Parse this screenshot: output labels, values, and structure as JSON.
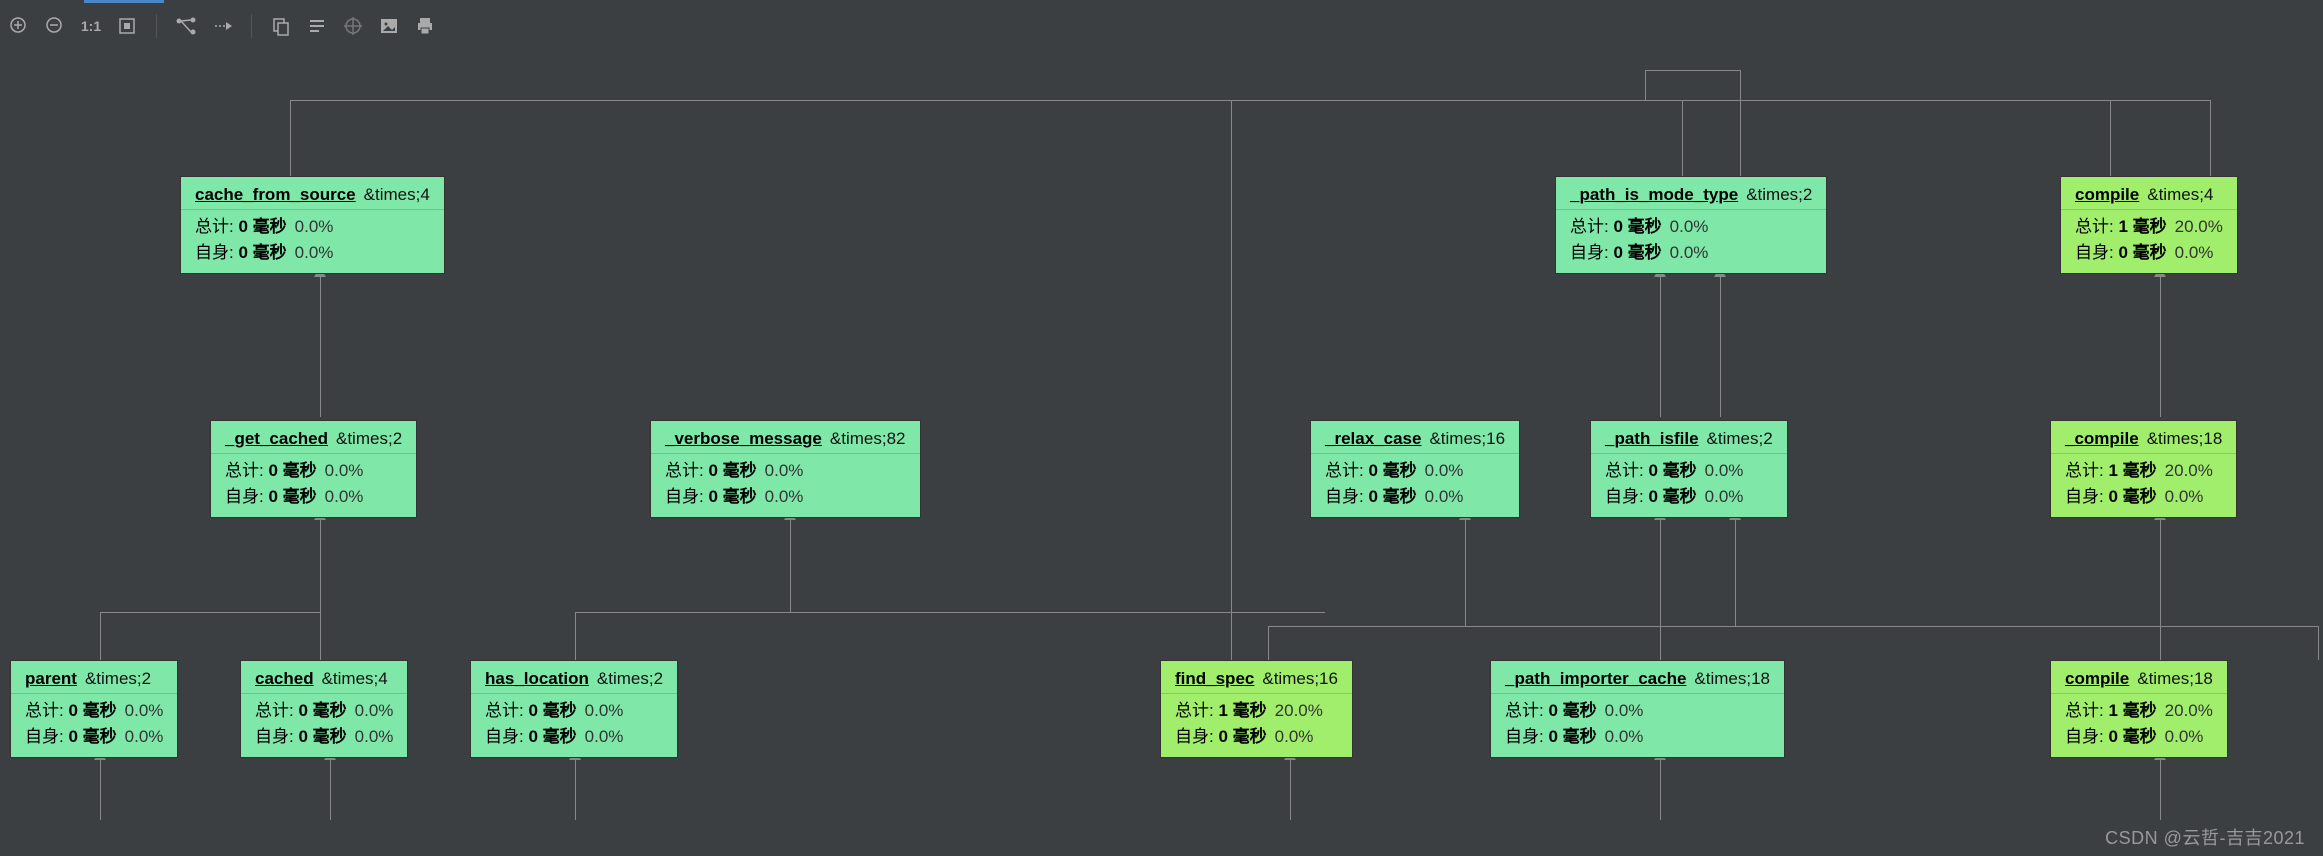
{
  "toolbar": {
    "icons": [
      "zoom-in",
      "zoom-out",
      "zoom-1-1",
      "fit",
      "graph",
      "forward",
      "copy",
      "list",
      "target",
      "image",
      "print"
    ],
    "one_to_one": "1:1"
  },
  "labels": {
    "total": "总计:",
    "self": "自身:",
    "times_prefix": "&times;"
  },
  "nodes": {
    "cache_from_source": {
      "name": "cache_from_source",
      "times": "4",
      "total_val": "0 毫秒",
      "total_pct": "0.0%",
      "self_val": "0 毫秒",
      "self_pct": "0.0%"
    },
    "path_is_mode_type": {
      "name": "_path_is_mode_type",
      "times": "2",
      "total_val": "0 毫秒",
      "total_pct": "0.0%",
      "self_val": "0 毫秒",
      "self_pct": "0.0%"
    },
    "compile_top": {
      "name": "compile",
      "times": "4",
      "total_val": "1 毫秒",
      "total_pct": "20.0%",
      "self_val": "0 毫秒",
      "self_pct": "0.0%"
    },
    "get_cached": {
      "name": "_get_cached",
      "times": "2",
      "total_val": "0 毫秒",
      "total_pct": "0.0%",
      "self_val": "0 毫秒",
      "self_pct": "0.0%"
    },
    "verbose_message": {
      "name": "_verbose_message",
      "times": "82",
      "total_val": "0 毫秒",
      "total_pct": "0.0%",
      "self_val": "0 毫秒",
      "self_pct": "0.0%"
    },
    "relax_case": {
      "name": "_relax_case",
      "times": "16",
      "total_val": "0 毫秒",
      "total_pct": "0.0%",
      "self_val": "0 毫秒",
      "self_pct": "0.0%"
    },
    "path_isfile": {
      "name": "_path_isfile",
      "times": "2",
      "total_val": "0 毫秒",
      "total_pct": "0.0%",
      "self_val": "0 毫秒",
      "self_pct": "0.0%"
    },
    "compile_mid": {
      "name": "_compile",
      "times": "18",
      "total_val": "1 毫秒",
      "total_pct": "20.0%",
      "self_val": "0 毫秒",
      "self_pct": "0.0%"
    },
    "parent": {
      "name": "parent",
      "times": "2",
      "total_val": "0 毫秒",
      "total_pct": "0.0%",
      "self_val": "0 毫秒",
      "self_pct": "0.0%"
    },
    "cached": {
      "name": "cached",
      "times": "4",
      "total_val": "0 毫秒",
      "total_pct": "0.0%",
      "self_val": "0 毫秒",
      "self_pct": "0.0%"
    },
    "has_location": {
      "name": "has_location",
      "times": "2",
      "total_val": "0 毫秒",
      "total_pct": "0.0%",
      "self_val": "0 毫秒",
      "self_pct": "0.0%"
    },
    "find_spec": {
      "name": "find_spec",
      "times": "16",
      "total_val": "1 毫秒",
      "total_pct": "20.0%",
      "self_val": "0 毫秒",
      "self_pct": "0.0%"
    },
    "path_importer_cache": {
      "name": "_path_importer_cache",
      "times": "18",
      "total_val": "0 毫秒",
      "total_pct": "0.0%",
      "self_val": "0 毫秒",
      "self_pct": "0.0%"
    },
    "compile_bot": {
      "name": "compile",
      "times": "18",
      "total_val": "1 毫秒",
      "total_pct": "20.0%",
      "self_val": "0 毫秒",
      "self_pct": "0.0%"
    }
  },
  "watermark": "CSDN @云哲-吉吉2021"
}
